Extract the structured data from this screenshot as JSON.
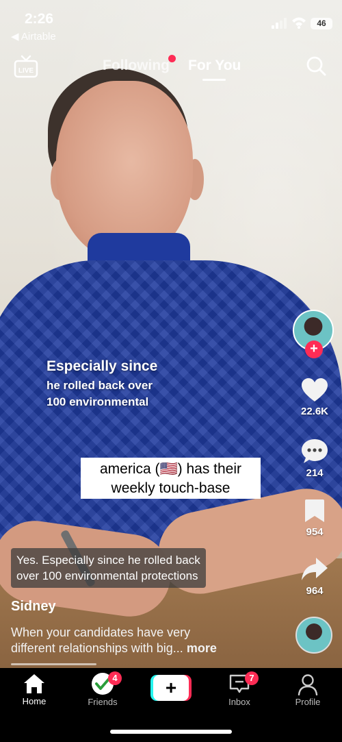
{
  "status_bar": {
    "time": "2:26",
    "back_app": "◀ Airtable",
    "battery": "46"
  },
  "top_nav": {
    "live_label": "LIVE",
    "tabs": [
      {
        "label": "Following",
        "active": false,
        "has_dot": true
      },
      {
        "label": "For You",
        "active": true
      }
    ],
    "search_icon": "search-icon"
  },
  "video": {
    "overlay_caption": {
      "line1": "Especially since",
      "line2": "he rolled back over",
      "line3": "100 environmental"
    },
    "sticker": {
      "line1": "america (🇺🇸) has their",
      "line2": "weekly touch-base"
    },
    "closed_caption": {
      "line1": "Yes. Especially since he rolled back",
      "line2": "over 100 environmental protections"
    },
    "author": "Sidney",
    "description": {
      "line1": "When your candidates have very",
      "line2": "different relationships with big...",
      "more": "more"
    },
    "progress": 0.25
  },
  "rail": {
    "likes": "22.6K",
    "comments": "214",
    "saves": "954",
    "shares": "964",
    "follow_plus": "+"
  },
  "bottom_nav": {
    "items": [
      {
        "label": "Home",
        "icon": "home-icon",
        "active": true
      },
      {
        "label": "Friends",
        "icon": "friends-icon",
        "badge": "4"
      },
      {
        "label": "",
        "icon": "create-icon"
      },
      {
        "label": "Inbox",
        "icon": "inbox-icon",
        "badge": "7"
      },
      {
        "label": "Profile",
        "icon": "profile-icon"
      }
    ],
    "create_symbol": "+"
  },
  "colors": {
    "accent_red": "#fe2c55",
    "accent_cyan": "#25f4ee"
  }
}
